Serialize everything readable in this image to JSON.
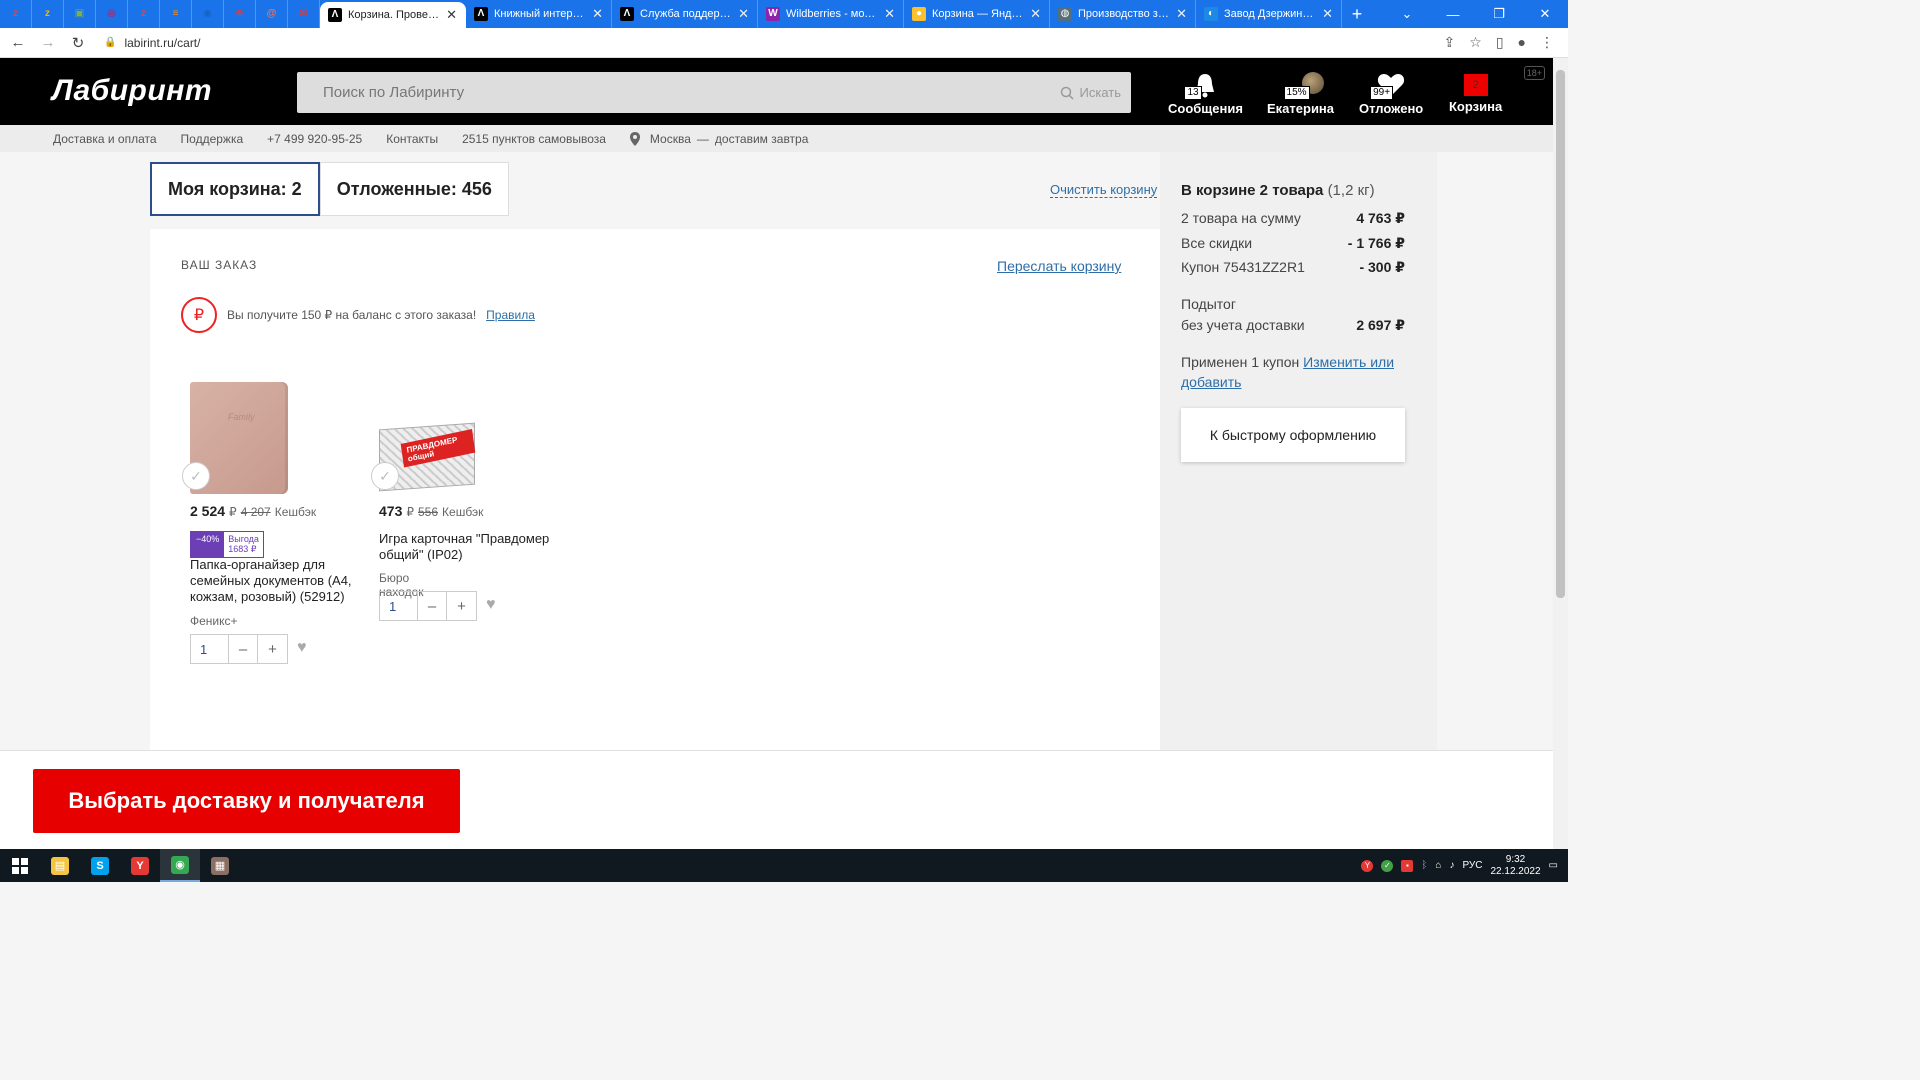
{
  "browser": {
    "mini_tabs": [
      {
        "icon": "z",
        "color": "#e8453c"
      },
      {
        "icon": "z",
        "color": "#f4b400"
      },
      {
        "icon": "▣",
        "color": "#7cb342"
      },
      {
        "icon": "◎",
        "color": "#c2185b"
      },
      {
        "icon": "z",
        "color": "#e8453c"
      },
      {
        "icon": "≡",
        "color": "#ff8f00"
      },
      {
        "icon": "◉",
        "color": "#1565c0"
      },
      {
        "icon": "⊕",
        "color": "#e53935"
      },
      {
        "icon": "@",
        "color": "#ff7043"
      },
      {
        "icon": "✉",
        "color": "#e53935"
      }
    ],
    "tabs": [
      {
        "title": "Корзина. Проверьте",
        "icon": "Λ",
        "icon_bg": "#000",
        "active": true
      },
      {
        "title": "Книжный интернет-м",
        "icon": "Λ",
        "icon_bg": "#000",
        "active": false
      },
      {
        "title": "Служба поддержки |",
        "icon": "Λ",
        "icon_bg": "#000",
        "active": false
      },
      {
        "title": "Wildberries - модный",
        "icon": "W",
        "icon_bg": "#8e24aa",
        "active": false
      },
      {
        "title": "Корзина — Яндекс М",
        "icon": "●",
        "icon_bg": "#fbc02d",
        "active": false
      },
      {
        "title": "Производство защи",
        "icon": "◍",
        "icon_bg": "#546e7a",
        "active": false
      },
      {
        "title": "Завод Дзержинских",
        "icon": "◐",
        "icon_bg": "#1e88e5",
        "active": false
      }
    ],
    "new_tab": "+",
    "url": "labirint.ru/cart/"
  },
  "header": {
    "logo": "Лабиринт",
    "search_placeholder": "Поиск по Лабиринту",
    "search_button": "Искать",
    "messages": {
      "label": "Сообщения",
      "badge": "13"
    },
    "profile": {
      "label": "Екатерина",
      "badge": "15%"
    },
    "postponed": {
      "label": "Отложено",
      "badge": "99+"
    },
    "cart": {
      "label": "Корзина",
      "count": "2"
    },
    "age": "18+"
  },
  "info_strip": {
    "delivery": "Доставка и оплата",
    "support": "Поддержка",
    "phone": "+7 499 920-95-25",
    "contacts": "Контакты",
    "pickup": "2515 пунктов самовывоза",
    "city": "Москва",
    "dash": "—",
    "delivery_time": "доставим завтра"
  },
  "cart_tabs": {
    "my_cart": "Моя корзина: 2",
    "postponed": "Отложенные: 456",
    "clear": "Очистить корзину"
  },
  "order": {
    "title": "ВАШ ЗАКАЗ",
    "share": "Переслать корзину",
    "cashback_text": "Вы получите 150 ₽ на баланс с этого заказа!",
    "cashback_link": "Правила",
    "rub_symbol": "₽"
  },
  "products": [
    {
      "price": "2 524",
      "currency": "₽",
      "old_price": "4 207",
      "cashback": "Кешбэк",
      "discount_pct": "−40%",
      "discount_save": "Выгода 1683 ₽",
      "title": "Папка-органайзер для семейных документов (А4, кожзам, розовый) (52912)",
      "brand": "Феникс+",
      "qty": "1",
      "emboss": "Family"
    },
    {
      "price": "473",
      "currency": "₽",
      "old_price": "556",
      "cashback": "Кешбэк",
      "title": "Игра карточная \"Правдомер общий\" (IP02)",
      "brand": "Бюро находок",
      "qty": "1",
      "box_label": "ПРАВДОМЕР общий"
    }
  ],
  "qty_controls": {
    "minus": "–",
    "plus": "+"
  },
  "summary": {
    "title": "В корзине 2 товара",
    "weight": "(1,2 кг)",
    "rows": [
      {
        "label": "2 товара на сумму",
        "value": "4 763 ₽"
      },
      {
        "label": "Все скидки",
        "value": "- 1 766 ₽"
      },
      {
        "label": "Купон 75431ZZ2R1",
        "value": "- 300 ₽"
      }
    ],
    "subtotal_label1": "Подытог",
    "subtotal_label2": "без учета доставки",
    "subtotal_value": "2 697 ₽",
    "coupon_text": "Применен 1 купон",
    "coupon_link": "Изменить или добавить",
    "quick_order": "К быстрому оформлению"
  },
  "cta": "Выбрать доставку и получателя",
  "taskbar": {
    "apps": [
      {
        "icon": "▤",
        "color": "#f4c542"
      },
      {
        "icon": "S",
        "color": "#00a2ed"
      },
      {
        "icon": "Y",
        "color": "#e53935"
      },
      {
        "icon": "◉",
        "color": "#34a853"
      },
      {
        "icon": "▦",
        "color": "#8d6e63"
      }
    ],
    "lang": "РУС",
    "time": "9:32",
    "date": "22.12.2022"
  }
}
